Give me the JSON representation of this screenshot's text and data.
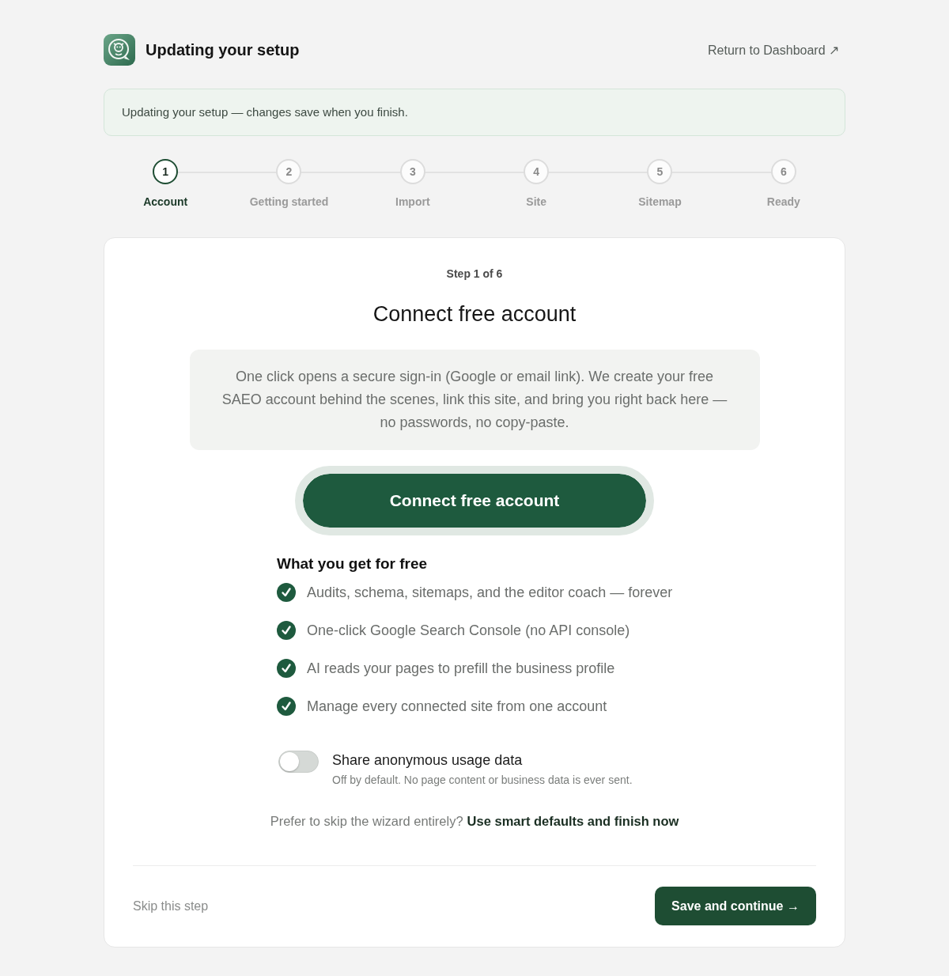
{
  "header": {
    "title": "Updating your setup",
    "return_link": "Return to Dashboard ↗"
  },
  "notice": {
    "text": "Updating your setup — changes save when you finish."
  },
  "steps": [
    {
      "number": "1",
      "label": "Account",
      "selected": true
    },
    {
      "number": "2",
      "label": "Getting started",
      "selected": false
    },
    {
      "number": "3",
      "label": "Import",
      "selected": false
    },
    {
      "number": "4",
      "label": "Site",
      "selected": false
    },
    {
      "number": "5",
      "label": "Sitemap",
      "selected": false
    },
    {
      "number": "6",
      "label": "Ready",
      "selected": false
    }
  ],
  "card": {
    "step_label": "Step 1 of 6",
    "title": "Connect free account",
    "info": "One click opens a secure sign-in (Google or email link). We create your free SAEO account behind the scenes, link this site, and bring you right back here — no passwords, no copy-paste.",
    "connect_button": "Connect free account",
    "benefits": {
      "heading": "What you get for free",
      "items": [
        "Audits, schema, sitemaps, and the editor coach — forever",
        "One-click Google Search Console (no API console)",
        "AI reads your pages to prefill the business profile",
        "Manage every connected site from one account"
      ]
    },
    "toggle": {
      "label": "Share anonymous usage data",
      "hint": "Off by default. No page content or business data is ever sent.",
      "on": false
    },
    "skip_prompt": {
      "text": "Prefer to skip the wizard entirely?",
      "link": "Use smart defaults and finish now"
    },
    "footer": {
      "skip": "Skip this step",
      "save": "Save and continue →"
    }
  }
}
